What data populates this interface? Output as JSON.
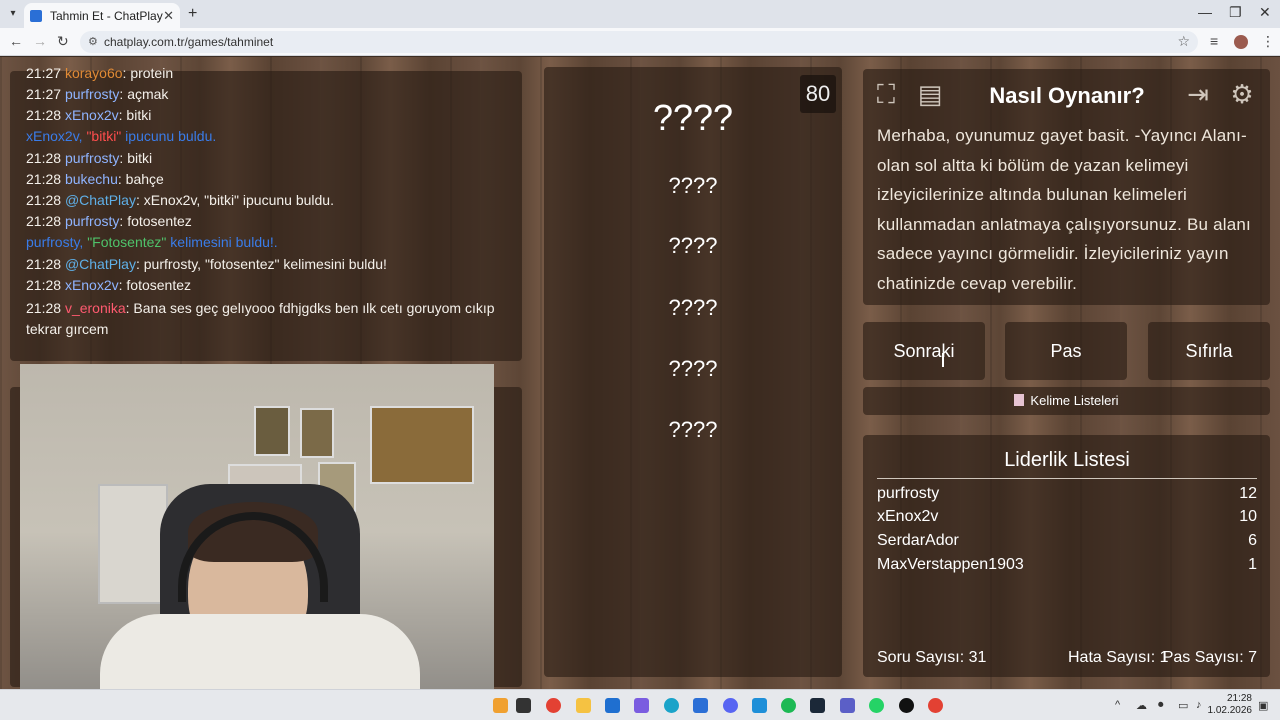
{
  "browser": {
    "tab_title": "Tahmin Et - ChatPlay",
    "new_tab": "+",
    "url": "chatplay.com.tr/games/tahminet"
  },
  "chat": {
    "messages": [
      {
        "time": "21:27",
        "user": "korayo6o",
        "sep": ": ",
        "text": "protein"
      },
      {
        "time": "21:27",
        "user": "purfrosty",
        "sep": ": ",
        "text": "açmak"
      },
      {
        "time": "21:28",
        "user": "xEnox2v",
        "sep": ": ",
        "text": "bitki"
      },
      {
        "system": true,
        "pre": "xEnox2v, ",
        "hl": "\"bitki\"",
        "post": " ipucunu buldu."
      },
      {
        "time": "21:28",
        "user": "purfrosty",
        "sep": ": ",
        "text": "bitki"
      },
      {
        "time": "21:28",
        "user": "bukechu",
        "sep": ": ",
        "text": "bahçe"
      },
      {
        "time": "21:28",
        "user": "@ChatPlay",
        "sep": ": ",
        "text": "xEnox2v, \"bitki\" ipucunu buldu."
      },
      {
        "time": "21:28",
        "user": "purfrosty",
        "sep": ": ",
        "text": "fotosentez"
      },
      {
        "system": true,
        "pre": "purfrosty, ",
        "hl": "\"Fotosentez\"",
        "post": " kelimesini buldu!."
      },
      {
        "time": "21:28",
        "user": "@ChatPlay",
        "sep": ": ",
        "text": "purfrosty, \"fotosentez\" kelimesini buldu!"
      },
      {
        "time": "21:28",
        "user": "xEnox2v",
        "sep": ": ",
        "text": "fotosentez"
      },
      {
        "time": "21:28",
        "user": "v_eronika",
        "sep": ": ",
        "text": "Bana ses geç gelıyooo fdhjgdks ben ılk cetı goruyom cıkıp tekrar gırcem"
      }
    ]
  },
  "game": {
    "counter": "80",
    "words": [
      "????",
      "????",
      "????",
      "????",
      "????",
      "????"
    ]
  },
  "howto": {
    "title": "Nasıl Oynanır?",
    "text": "Merhaba, oyunumuz gayet basit. -Yayıncı Alanı- olan sol altta ki bölüm de yazan kelimeyi izleyicilerinize altında bulunan kelimeleri kullanmadan anlatmaya çalışıyorsunuz. Bu alanı sadece yayıncı görmelidir. İzleyicileriniz yayın chatinizde cevap verebilir."
  },
  "buttons": {
    "next": "Sonraki",
    "pass": "Pas",
    "reset": "Sıfırla",
    "word_lists": "Kelime Listeleri"
  },
  "leaderboard": {
    "title": "Liderlik Listesi",
    "rows": [
      {
        "name": "purfrosty",
        "score": "12"
      },
      {
        "name": "xEnox2v",
        "score": "10"
      },
      {
        "name": "SerdarAdor",
        "score": "6"
      },
      {
        "name": "MaxVerstappen1903",
        "score": "1"
      }
    ],
    "questions": "Soru Sayısı: 31",
    "errors": "Hata Sayısı: 1",
    "passes": "Pas Sayısı: 7"
  },
  "taskbar": {
    "time": "21:28",
    "date": "1.02.2026"
  },
  "colors": {
    "user_orange": "#e08a35",
    "user_blue": "#8fb4ff",
    "user_cyan": "#5fb0e8",
    "user_red": "#ff5a70",
    "system_blue": "#3a7ce8",
    "highlight_red": "#ff4d4d",
    "highlight_green": "#4fc26a"
  }
}
